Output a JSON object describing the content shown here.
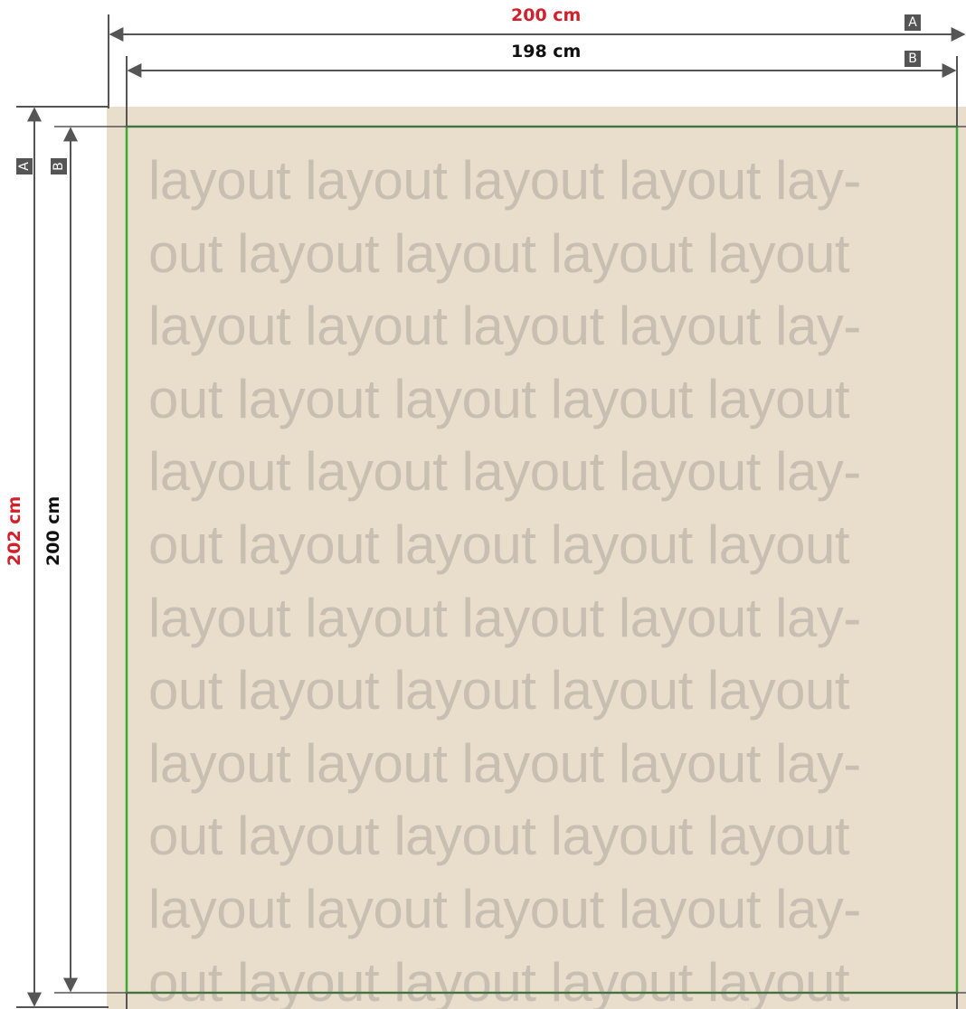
{
  "dimensions": {
    "width_outer": "200 cm",
    "width_inner": "198 cm",
    "height_outer": "202 cm",
    "height_inner": "200 cm",
    "tag_outer": "A",
    "tag_inner": "B"
  },
  "filler_lines": [
    "layout layout layout layout lay-",
    "out layout layout layout layout",
    "layout layout layout layout lay-",
    "out layout layout layout layout",
    "layout layout layout layout lay-",
    "out layout layout layout layout",
    "layout layout layout layout lay-",
    "out layout layout layout layout",
    "layout layout layout layout lay-",
    "out layout layout layout layout",
    "layout layout layout layout lay-",
    "out layout layout layout layout"
  ],
  "colors": {
    "background_area": "#e8decb",
    "filler_text": "#c8bfb2",
    "safe_zone_line": "#3aaa35",
    "outer_label": "#d0202b",
    "inner_label": "#111111",
    "dimension_line": "#555555"
  }
}
